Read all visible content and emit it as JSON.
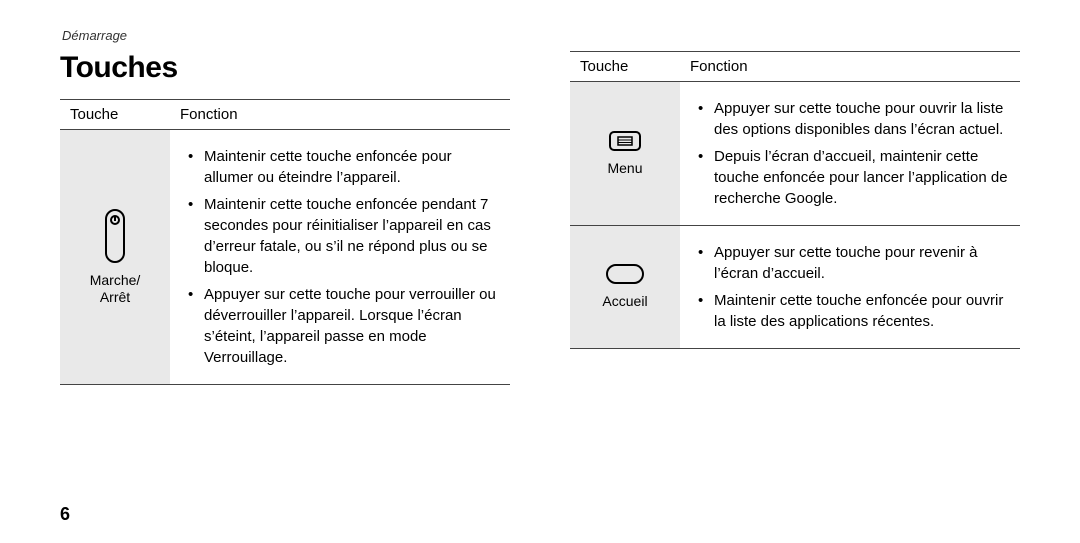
{
  "running_head": "Démarrage",
  "title": "Touches",
  "page_number": "6",
  "table_headers": {
    "key": "Touche",
    "func": "Fonction"
  },
  "left_table": {
    "rows": [
      {
        "icon": "power-button-icon",
        "label": "Marche/\nArrêt",
        "bullets": [
          "Maintenir cette touche enfoncée pour allumer ou éteindre l’appareil.",
          "Maintenir cette touche enfoncée pendant 7 secondes pour réinitialiser l’appareil en cas d’erreur fatale, ou s’il ne répond plus ou se bloque.",
          "Appuyer sur cette touche pour verrouiller ou déverrouiller l’appareil. Lorsque l’écran s’éteint, l’appareil passe en mode Verrouillage."
        ]
      }
    ]
  },
  "right_table": {
    "rows": [
      {
        "icon": "menu-key-icon",
        "label": "Menu",
        "bullets": [
          "Appuyer sur cette touche pour ouvrir la liste des options disponibles dans l’écran actuel.",
          "Depuis l’écran d’accueil, maintenir cette touche enfoncée pour lancer l’application de recherche Google."
        ]
      },
      {
        "icon": "home-key-icon",
        "label": "Accueil",
        "bullets": [
          "Appuyer sur cette touche pour revenir à l’écran d’accueil.",
          "Maintenir cette touche enfoncée pour ouvrir la liste des applications récentes."
        ]
      }
    ]
  }
}
